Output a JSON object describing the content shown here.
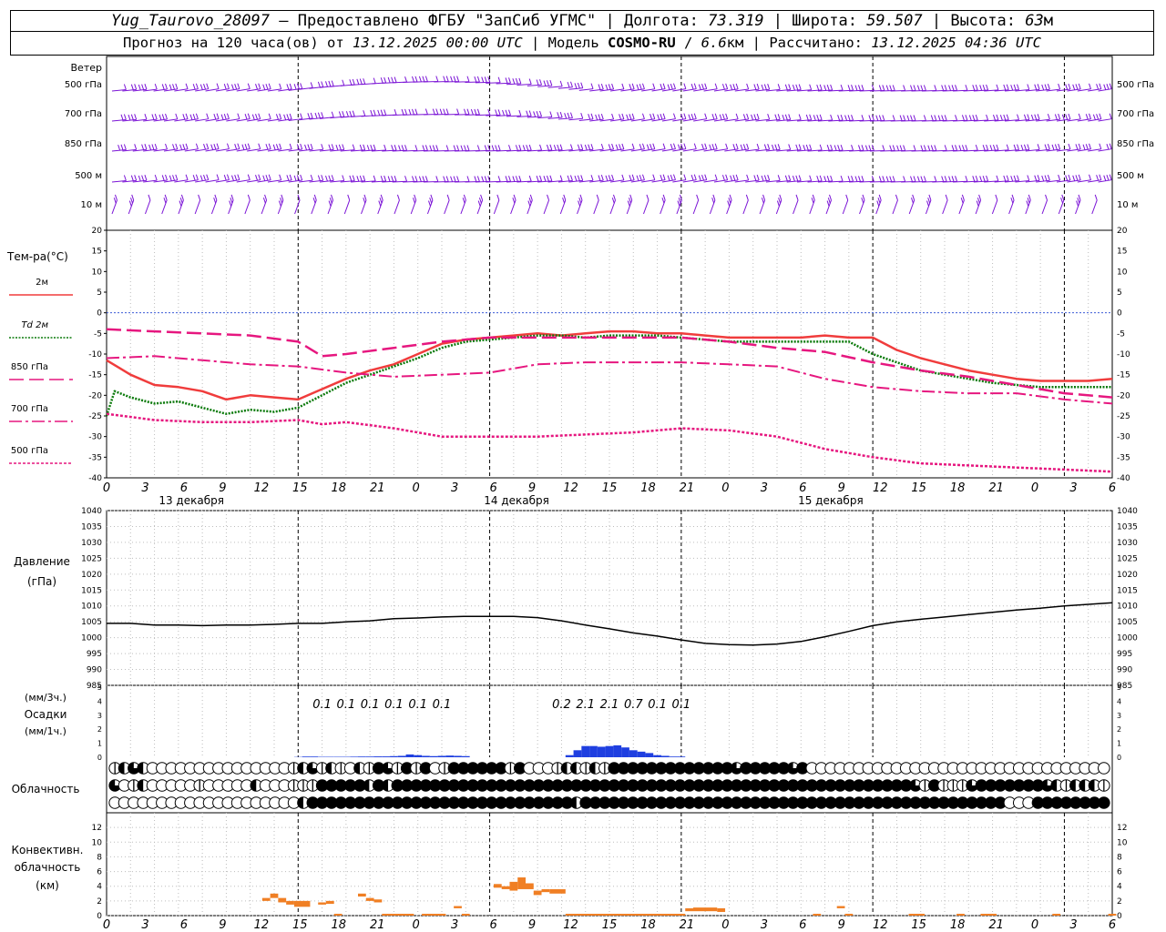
{
  "header": {
    "station": "Yug_Taurovo_28097",
    "dash": "–",
    "provided": "Предоставлено ФГБУ \"ЗапСиб УГМС\"",
    "lon_label": "Долгота:",
    "lon": "73.319",
    "lat_label": "Широта:",
    "lat": "59.507",
    "alt_label": "Высота:",
    "alt": "63",
    "alt_unit": "м",
    "forecast_prefix": "Прогноз на 120 часа(ов) от",
    "forecast_from": "13.12.2025 00:00 UTC",
    "model_label": "Модель",
    "model": "COSMO-RU",
    "resolution": "6.6",
    "res_unit": "км",
    "calc_label": "Рассчитано:",
    "calc_time": "13.12.2025 04:36 UTC"
  },
  "axis": {
    "hours": [
      "0",
      "3",
      "6",
      "9",
      "12",
      "15",
      "18",
      "21",
      "0",
      "3",
      "6",
      "9",
      "12",
      "15",
      "18",
      "21",
      "0",
      "3",
      "6",
      "9",
      "12",
      "15",
      "18",
      "21",
      "0",
      "3",
      "6"
    ],
    "days": [
      "13 декабря",
      "14 декабря",
      "15 декабря"
    ]
  },
  "colors": {
    "wind": "#7b14d6",
    "t2m": "#f03c3c",
    "td2m": "#0a7a0a",
    "t850": "#e6177f",
    "t700": "#e6177f",
    "t500": "#e6177f",
    "zero_line": "#3b5bd6",
    "pressure": "#000000",
    "precip": "#1f3fe0",
    "convective": "#f07f24"
  },
  "chart_data": [
    {
      "type": "wind_barbs",
      "title": "Ветер",
      "levels": [
        "500 гПа",
        "700 гПа",
        "850 гПа",
        "500 м",
        "10  м"
      ],
      "note": "barb sequences are drawn procedurally along each level"
    },
    {
      "type": "line",
      "ylabel": "Тем-ра(°C)",
      "ylim": [
        -40,
        20
      ],
      "yticks": [
        "20",
        "15",
        "10",
        "5",
        "0",
        "-5",
        "-10",
        "-15",
        "-20",
        "-25",
        "-30",
        "-35",
        "-40"
      ],
      "legend": [
        {
          "name": "2м",
          "style": "solid"
        },
        {
          "name": "Td  2м",
          "style": "dotted"
        },
        {
          "name": "850 гПа",
          "style": "long-dash"
        },
        {
          "name": "700 гПа",
          "style": "dash-dot"
        },
        {
          "name": "500 гПа",
          "style": "short-dash"
        }
      ],
      "series": [
        {
          "key": "t2m",
          "x": [
            0,
            3,
            6,
            9,
            12,
            15,
            18,
            21,
            24,
            27,
            30,
            33,
            36,
            39,
            42,
            45,
            48,
            51,
            54,
            57,
            60,
            63,
            66,
            69,
            72,
            75,
            78,
            81,
            84,
            87,
            90,
            93,
            96,
            99,
            102,
            105,
            108,
            111,
            114,
            117,
            120,
            123,
            126
          ],
          "y": [
            -11.5,
            -15,
            -17.5,
            -18,
            -19,
            -21,
            -20,
            -20.5,
            -21,
            -18.5,
            -16,
            -14,
            -12.5,
            -10,
            -7.5,
            -6.5,
            -6,
            -5.5,
            -5,
            -5.5,
            -5,
            -4.5,
            -4.5,
            -5,
            -5,
            -5.5,
            -6,
            -6,
            -6,
            -6,
            -5.5,
            -6,
            -6,
            -9,
            -11,
            -12.5,
            -14,
            -15,
            -16,
            -16.5,
            -16.5,
            -16.5,
            -16
          ]
        },
        {
          "key": "td2m",
          "x": [
            0,
            1,
            3,
            6,
            9,
            12,
            15,
            18,
            21,
            24,
            27,
            30,
            33,
            36,
            39,
            42,
            45,
            48,
            51,
            54,
            57,
            60,
            63,
            66,
            69,
            72,
            75,
            78,
            81,
            84,
            87,
            90,
            93,
            96,
            99,
            102,
            105,
            108,
            111,
            114,
            117,
            120,
            123,
            126
          ],
          "y": [
            -25,
            -19,
            -20.5,
            -22,
            -21.5,
            -23,
            -24.5,
            -23.5,
            -24,
            -23,
            -20,
            -17,
            -15,
            -13,
            -11,
            -8.5,
            -7,
            -6.5,
            -6,
            -5.5,
            -5.5,
            -6,
            -5.5,
            -5.5,
            -5.5,
            -6,
            -6.5,
            -7,
            -7,
            -7,
            -7,
            -7,
            -7,
            -10,
            -12,
            -14,
            -15,
            -16,
            -17,
            -17.5,
            -18,
            -18,
            -18,
            -18
          ]
        },
        {
          "key": "t850",
          "x": [
            0,
            6,
            12,
            18,
            24,
            27,
            30,
            36,
            42,
            48,
            54,
            60,
            66,
            72,
            78,
            84,
            90,
            96,
            102,
            108,
            114,
            120,
            126
          ],
          "y": [
            -4,
            -4.5,
            -5,
            -5.5,
            -7,
            -10.5,
            -10,
            -8.5,
            -7,
            -6,
            -6,
            -6,
            -6,
            -6,
            -7,
            -8.5,
            -9.5,
            -12,
            -14,
            -15.5,
            -17.5,
            -19.5,
            -20.5
          ]
        },
        {
          "key": "t700",
          "x": [
            0,
            6,
            12,
            18,
            24,
            30,
            36,
            42,
            48,
            54,
            60,
            66,
            72,
            78,
            84,
            90,
            96,
            102,
            108,
            114,
            120,
            126
          ],
          "y": [
            -11,
            -10.5,
            -11.5,
            -12.5,
            -13,
            -14.5,
            -15.5,
            -15,
            -14.5,
            -12.5,
            -12,
            -12,
            -12,
            -12.5,
            -13,
            -16,
            -18,
            -19,
            -19.5,
            -19.5,
            -21,
            -22
          ]
        },
        {
          "key": "t500",
          "x": [
            0,
            6,
            12,
            18,
            24,
            27,
            30,
            36,
            42,
            48,
            54,
            60,
            66,
            72,
            78,
            84,
            90,
            96,
            102,
            108,
            114,
            120,
            126
          ],
          "y": [
            -24.5,
            -26,
            -26.5,
            -26.5,
            -26,
            -27,
            -26.5,
            -28,
            -30,
            -30,
            -30,
            -29.5,
            -29,
            -28,
            -28.5,
            -30,
            -33,
            -35,
            -36.5,
            -37,
            -37.5,
            -38,
            -38.5
          ]
        }
      ]
    },
    {
      "type": "line",
      "ylabel": "Давление",
      "ylabel2": "(гПа)",
      "ylim": [
        985,
        1040
      ],
      "yticks": [
        "1040",
        "1035",
        "1030",
        "1025",
        "1020",
        "1015",
        "1010",
        "1005",
        "1000",
        "995",
        "990",
        "985"
      ],
      "series": [
        {
          "key": "pressure",
          "x": [
            0,
            3,
            6,
            9,
            12,
            15,
            18,
            21,
            24,
            27,
            30,
            33,
            36,
            39,
            42,
            45,
            48,
            51,
            54,
            57,
            60,
            63,
            66,
            69,
            72,
            75,
            78,
            81,
            84,
            87,
            90,
            93,
            96,
            99,
            102,
            105,
            108,
            111,
            114,
            117,
            120,
            123,
            126
          ],
          "y": [
            1004.5,
            1004.5,
            1004,
            1004,
            1003.8,
            1004,
            1004,
            1004.2,
            1004.5,
            1004.5,
            1005,
            1005.3,
            1006,
            1006.2,
            1006.5,
            1006.7,
            1006.7,
            1006.7,
            1006.3,
            1005.3,
            1004,
            1002.8,
            1001.5,
            1000.5,
            999.3,
            998.2,
            997.8,
            997.7,
            998,
            998.8,
            1000.3,
            1002,
            1003.8,
            1005,
            1005.8,
            1006.5,
            1007.3,
            1008,
            1008.7,
            1009.3,
            1010,
            1010.5,
            1011
          ]
        }
      ]
    },
    {
      "type": "bar",
      "ylabel": "(мм/3ч.)",
      "ylabel2": "Осадки",
      "ylabel3": "(мм/1ч.)",
      "ylim": [
        0,
        5
      ],
      "yticks": [
        "5",
        "4",
        "3",
        "2",
        "1",
        "0"
      ],
      "labels": [
        {
          "x": 27,
          "text": "0.1"
        },
        {
          "x": 30,
          "text": "0.1"
        },
        {
          "x": 33,
          "text": "0.1"
        },
        {
          "x": 36,
          "text": "0.1"
        },
        {
          "x": 39,
          "text": "0.1"
        },
        {
          "x": 42,
          "text": "0.1"
        },
        {
          "x": 57,
          "text": "0.2"
        },
        {
          "x": 60,
          "text": "2.1"
        },
        {
          "x": 63,
          "text": "2.1"
        },
        {
          "x": 66,
          "text": "0.7"
        },
        {
          "x": 69,
          "text": "0.1"
        },
        {
          "x": 72,
          "text": "0.1"
        }
      ],
      "hours": [
        24,
        25,
        26,
        27,
        28,
        29,
        30,
        31,
        32,
        33,
        34,
        35,
        36,
        37,
        38,
        39,
        40,
        41,
        42,
        43,
        44,
        45,
        58,
        59,
        60,
        61,
        62,
        63,
        64,
        65,
        66,
        67,
        68,
        69,
        70,
        71,
        72
      ],
      "values": [
        0.02,
        0.05,
        0.05,
        0.03,
        0.03,
        0.03,
        0.03,
        0.04,
        0.05,
        0.05,
        0.06,
        0.06,
        0.08,
        0.1,
        0.2,
        0.15,
        0.1,
        0.08,
        0.1,
        0.12,
        0.1,
        0.08,
        0.15,
        0.5,
        0.8,
        0.8,
        0.75,
        0.8,
        0.85,
        0.7,
        0.5,
        0.4,
        0.3,
        0.15,
        0.1,
        0.05,
        0.05
      ]
    },
    {
      "type": "cloud_symbols",
      "ylabel": "Облачность",
      "rows": [
        "1232000000000000000123121021431414014444441400012212144444444444443444443400000000000000000000000000000000",
        "3012000001000002000111444442424444444444444444444444444444444444444444444444444444444314111344444443212221",
        "0000000000000000000024444444444444444444444444444244444444444444444444444444444444444444444444400044444444"
      ],
      "note": "0=clear 1=quarter 2=half 3=three-quarter 4=overcast"
    },
    {
      "type": "bar",
      "ylabel": "Конвективн.",
      "ylabel2": "облачность",
      "ylabel3": "(км)",
      "ylim": [
        0,
        14
      ],
      "yticks": [
        "12",
        "10",
        "8",
        "6",
        "4",
        "2",
        "0"
      ],
      "segments": [
        {
          "x0": 19.5,
          "x1": 20.5,
          "lo": 2.0,
          "hi": 2.4
        },
        {
          "x0": 20.5,
          "x1": 21.5,
          "lo": 2.4,
          "hi": 3.0
        },
        {
          "x0": 21.5,
          "x1": 22.5,
          "lo": 1.8,
          "hi": 2.4
        },
        {
          "x0": 22.5,
          "x1": 23.5,
          "lo": 1.5,
          "hi": 2.0
        },
        {
          "x0": 23.5,
          "x1": 25.5,
          "lo": 1.2,
          "hi": 2.0
        },
        {
          "x0": 26.5,
          "x1": 27.5,
          "lo": 1.5,
          "hi": 1.8
        },
        {
          "x0": 27.5,
          "x1": 28.5,
          "lo": 1.6,
          "hi": 2.0
        },
        {
          "x0": 28.5,
          "x1": 29.5,
          "lo": 0.0,
          "hi": 0.25
        },
        {
          "x0": 31.5,
          "x1": 32.5,
          "lo": 2.6,
          "hi": 3.0
        },
        {
          "x0": 32.5,
          "x1": 33.5,
          "lo": 2.0,
          "hi": 2.4
        },
        {
          "x0": 33.5,
          "x1": 34.5,
          "lo": 1.8,
          "hi": 2.2
        },
        {
          "x0": 34.5,
          "x1": 38.5,
          "lo": 0.0,
          "hi": 0.25
        },
        {
          "x0": 39.5,
          "x1": 42.5,
          "lo": 0.0,
          "hi": 0.25
        },
        {
          "x0": 43.5,
          "x1": 44.5,
          "lo": 1.0,
          "hi": 1.3
        },
        {
          "x0": 44.5,
          "x1": 45.5,
          "lo": 0.0,
          "hi": 0.25
        },
        {
          "x0": 48.5,
          "x1": 49.5,
          "lo": 3.8,
          "hi": 4.3
        },
        {
          "x0": 49.5,
          "x1": 50.5,
          "lo": 3.6,
          "hi": 4.0
        },
        {
          "x0": 50.5,
          "x1": 51.5,
          "lo": 3.4,
          "hi": 4.6
        },
        {
          "x0": 51.5,
          "x1": 52.5,
          "lo": 3.6,
          "hi": 5.2
        },
        {
          "x0": 52.5,
          "x1": 53.5,
          "lo": 3.6,
          "hi": 4.4
        },
        {
          "x0": 53.5,
          "x1": 54.5,
          "lo": 2.8,
          "hi": 3.4
        },
        {
          "x0": 54.5,
          "x1": 55.5,
          "lo": 3.2,
          "hi": 3.6
        },
        {
          "x0": 55.5,
          "x1": 57.5,
          "lo": 3.0,
          "hi": 3.6
        },
        {
          "x0": 57.5,
          "x1": 72.5,
          "lo": 0.0,
          "hi": 0.25
        },
        {
          "x0": 72.5,
          "x1": 73.5,
          "lo": 0.6,
          "hi": 1.0
        },
        {
          "x0": 73.5,
          "x1": 76.5,
          "lo": 0.6,
          "hi": 1.1
        },
        {
          "x0": 76.5,
          "x1": 77.5,
          "lo": 0.5,
          "hi": 1.0
        },
        {
          "x0": 88.5,
          "x1": 89.5,
          "lo": 0.0,
          "hi": 0.25
        },
        {
          "x0": 91.5,
          "x1": 92.5,
          "lo": 1.0,
          "hi": 1.3
        },
        {
          "x0": 92.5,
          "x1": 93.5,
          "lo": 0.0,
          "hi": 0.25
        },
        {
          "x0": 100.5,
          "x1": 102.5,
          "lo": 0.0,
          "hi": 0.25
        },
        {
          "x0": 106.5,
          "x1": 107.5,
          "lo": 0.0,
          "hi": 0.25
        },
        {
          "x0": 109.5,
          "x1": 111.5,
          "lo": 0.0,
          "hi": 0.25
        },
        {
          "x0": 118.5,
          "x1": 119.5,
          "lo": 0.0,
          "hi": 0.25
        },
        {
          "x0": 125.5,
          "x1": 126.5,
          "lo": 0.0,
          "hi": 0.25
        }
      ]
    }
  ]
}
